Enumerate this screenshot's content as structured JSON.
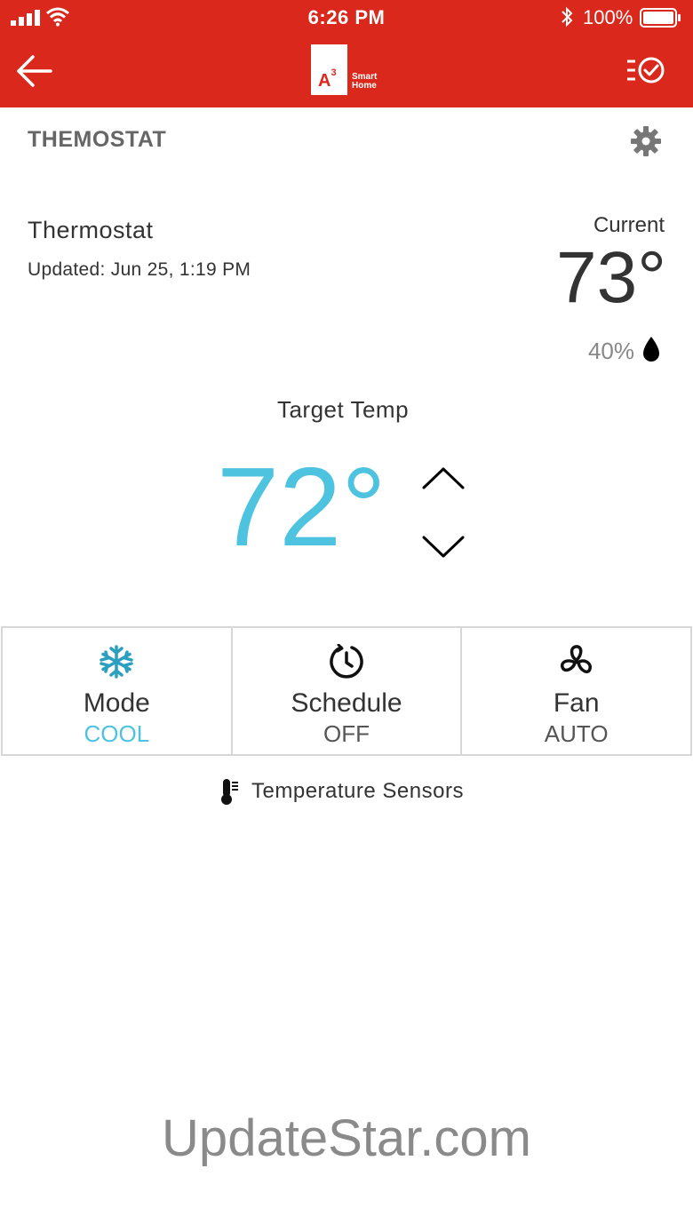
{
  "status_bar": {
    "time": "6:26 PM",
    "battery_percent": "100%"
  },
  "header": {
    "logo_text": "A3",
    "logo_sup": "3",
    "logo_smart": "Smart",
    "logo_home": "Home",
    "brand_color": "#da291c"
  },
  "section": {
    "title": "THEMOSTAT"
  },
  "device": {
    "name": "Thermostat",
    "updated": "Updated: Jun 25, 1:19 PM",
    "current_label": "Current",
    "current_temp": "73°",
    "humidity": "40%"
  },
  "target": {
    "label": "Target Temp",
    "temp": "72°",
    "accent_color": "#4ec3e0"
  },
  "controls": [
    {
      "label": "Mode",
      "value": "COOL",
      "icon": "snowflake-icon"
    },
    {
      "label": "Schedule",
      "value": "OFF",
      "icon": "schedule-clock-icon"
    },
    {
      "label": "Fan",
      "value": "AUTO",
      "icon": "fan-icon"
    }
  ],
  "sensors": {
    "label": "Temperature Sensors"
  },
  "watermark": {
    "text": "UpdateStar.com"
  }
}
